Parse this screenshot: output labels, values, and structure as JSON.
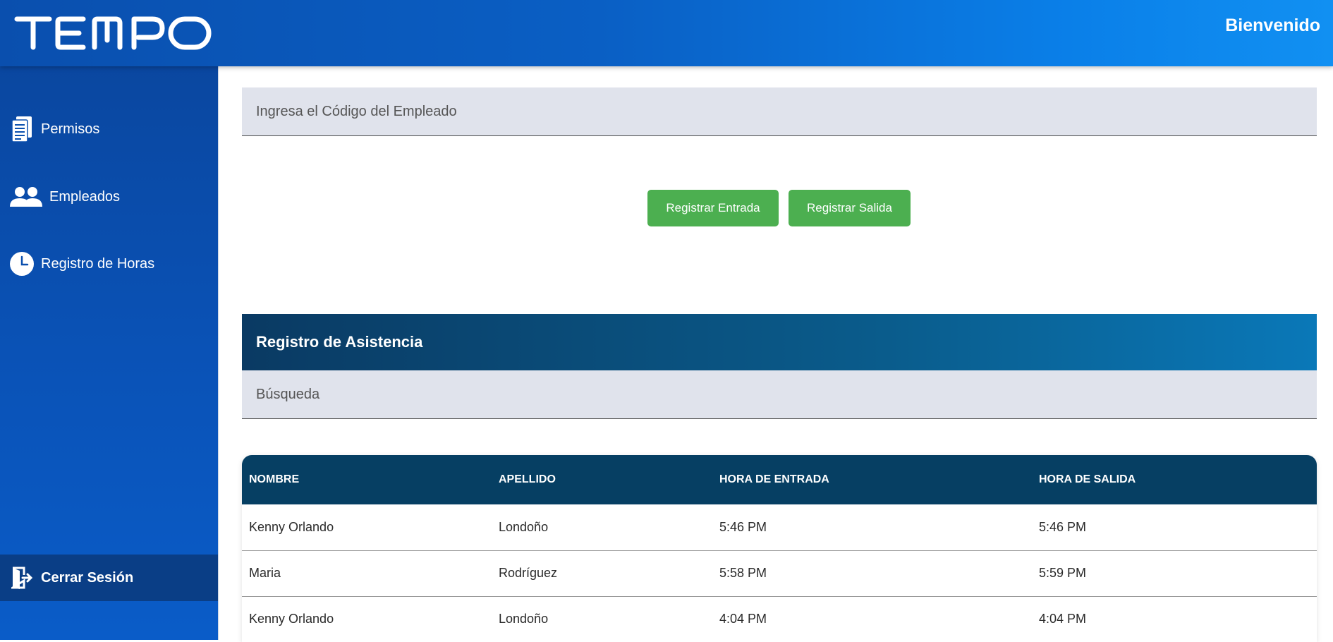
{
  "header": {
    "logo_text": "TEMPO",
    "welcome": "Bienvenido"
  },
  "sidebar": {
    "items": [
      {
        "label": "Permisos",
        "icon": "document-icon"
      },
      {
        "label": "Empleados",
        "icon": "users-icon"
      },
      {
        "label": "Registro de Horas",
        "icon": "clock-icon"
      }
    ],
    "logout": {
      "label": "Cerrar Sesión",
      "icon": "logout-icon"
    }
  },
  "main": {
    "employee_code": {
      "placeholder": "Ingresa el Código del Empleado",
      "value": ""
    },
    "buttons": {
      "check_in": "Registrar Entrada",
      "check_out": "Registrar Salida"
    },
    "attendance": {
      "title": "Registro de Asistencia",
      "search": {
        "placeholder": "Búsqueda",
        "value": ""
      },
      "columns": [
        "NOMBRE",
        "APELLIDO",
        "HORA DE ENTRADA",
        "HORA DE SALIDA"
      ],
      "rows": [
        [
          "Kenny Orlando",
          "Londoño",
          "5:46 PM",
          "5:46 PM"
        ],
        [
          "Maria",
          "Rodríguez",
          "5:58 PM",
          "5:59 PM"
        ],
        [
          "Kenny Orlando",
          "Londoño",
          "4:04 PM",
          "4:04 PM"
        ]
      ]
    }
  },
  "colors": {
    "header_start": "#0a4fae",
    "header_end": "#1190f2",
    "sidebar": "#0a52b6",
    "logout_bg": "#0a3e86",
    "button_green": "#4caf50",
    "table_header": "#063f63"
  }
}
